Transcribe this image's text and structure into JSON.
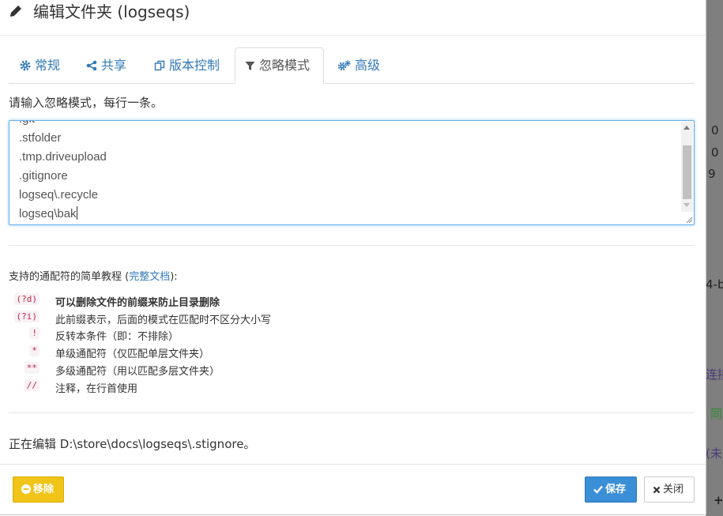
{
  "header": {
    "title": "编辑文件夹 (logseqs)"
  },
  "tabs": [
    {
      "label": "常规"
    },
    {
      "label": "共享"
    },
    {
      "label": "版本控制"
    },
    {
      "label": "忽略模式"
    },
    {
      "label": "高级"
    }
  ],
  "ignore": {
    "instruction": "请输入忽略模式，每行一条。",
    "lines": [
      ".git",
      ".stfolder",
      ".tmp.driveupload",
      ".gitignore",
      "logseq\\.recycle",
      "logseq\\bak"
    ]
  },
  "help": {
    "intro_text": "支持的通配符的简单教程 (",
    "intro_link": "完整文档",
    "intro_end": "):",
    "patterns": [
      {
        "code": "(?d)",
        "desc": "可以删除文件的前缀来防止目录删除",
        "bold": true
      },
      {
        "code": "(?i)",
        "desc": "此前缀表示，后面的模式在匹配时不区分大小写"
      },
      {
        "code": "!",
        "desc": "反转本条件（即：不排除）"
      },
      {
        "code": "*",
        "desc": "单级通配符（仅匹配单层文件夹）"
      },
      {
        "code": "**",
        "desc": "多级通配符（用以匹配多层文件夹）"
      },
      {
        "code": "//",
        "desc": "注释，在行首使用"
      }
    ]
  },
  "editing_path": "正在编辑 D:\\store\\docs\\logseqs\\.stignore。",
  "buttons": {
    "remove": "移除",
    "save": "保存",
    "close": "关闭"
  },
  "background_fragments": [
    "0",
    "0",
    "9",
    "4-b",
    "连接",
    "同",
    "(未",
    "+"
  ],
  "colors": {
    "link": "#337ab7",
    "warning": "#f0c419",
    "primary": "#3a8fd6",
    "code": "#c7254e"
  }
}
